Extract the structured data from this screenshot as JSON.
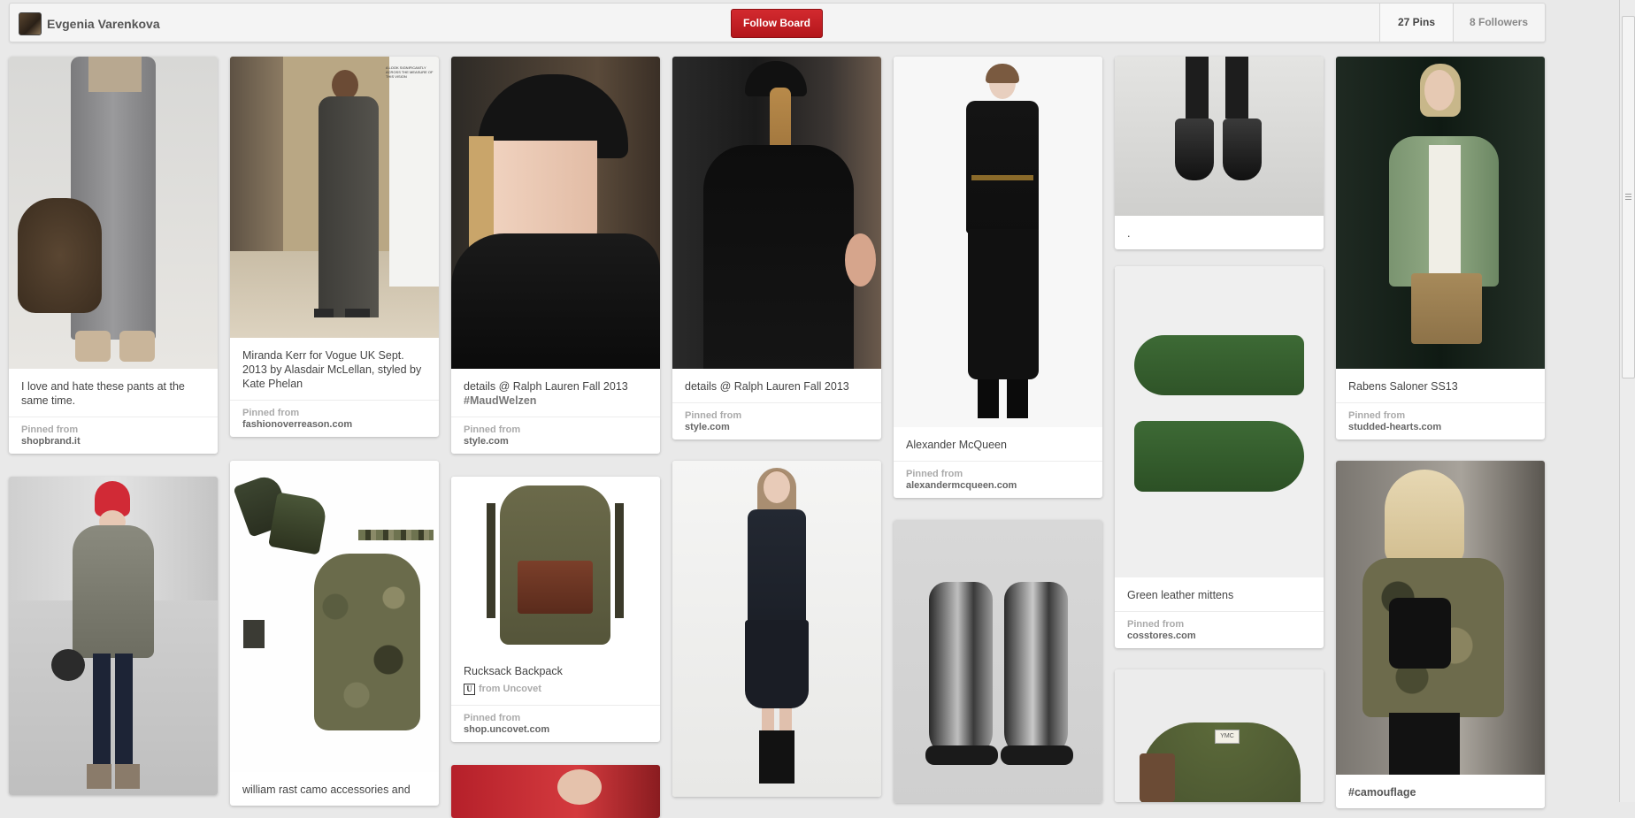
{
  "header": {
    "owner_name": "Evgenia Varenkova",
    "follow_label": "Follow Board",
    "pins_count": "27 Pins",
    "followers_count": "8 Followers"
  },
  "colors": {
    "brand_red": "#c8232c",
    "background": "#e9e9e9"
  },
  "pins": [
    {
      "description": "I love and hate these pants at the same time.",
      "pinned_label": "Pinned from",
      "source": "shopbrand.it"
    },
    {
      "description": "",
      "pinned_label": "",
      "source": ""
    },
    {
      "description": "Miranda Kerr for Vogue UK Sept. 2013 by Alasdair McLellan, styled by Kate Phelan",
      "pinned_label": "Pinned from",
      "source": "fashionoverreason.com",
      "magazine_text": "A LOOK SIGNIFICANTLY ACROSS THE MEASURE OF THIS VISION"
    },
    {
      "description": "william rast camo accessories and",
      "pinned_label": "",
      "source": ""
    },
    {
      "description": "details @ Ralph Lauren Fall 2013",
      "hashtag": "#MaudWelzen",
      "pinned_label": "Pinned from",
      "source": "style.com"
    },
    {
      "description": "Rucksack Backpack",
      "via_icon": "U",
      "via": "from Uncovet",
      "pinned_label": "Pinned from",
      "source": "shop.uncovet.com"
    },
    {
      "description": "details @ Ralph Lauren Fall 2013",
      "pinned_label": "Pinned from",
      "source": "style.com"
    },
    {
      "description": "Alexander McQueen",
      "pinned_label": "Pinned from",
      "source": "alexandermcqueen.com"
    },
    {
      "description": ".",
      "pinned_label": "",
      "source": ""
    },
    {
      "description": "Green leather mittens",
      "pinned_label": "Pinned from",
      "source": "cosstores.com"
    },
    {
      "description": "Rabens Saloner SS13",
      "pinned_label": "Pinned from",
      "source": "studded-hearts.com"
    },
    {
      "description": "#camouflage",
      "pinned_label": "",
      "source": ""
    },
    {
      "label_text": "YMC"
    }
  ]
}
